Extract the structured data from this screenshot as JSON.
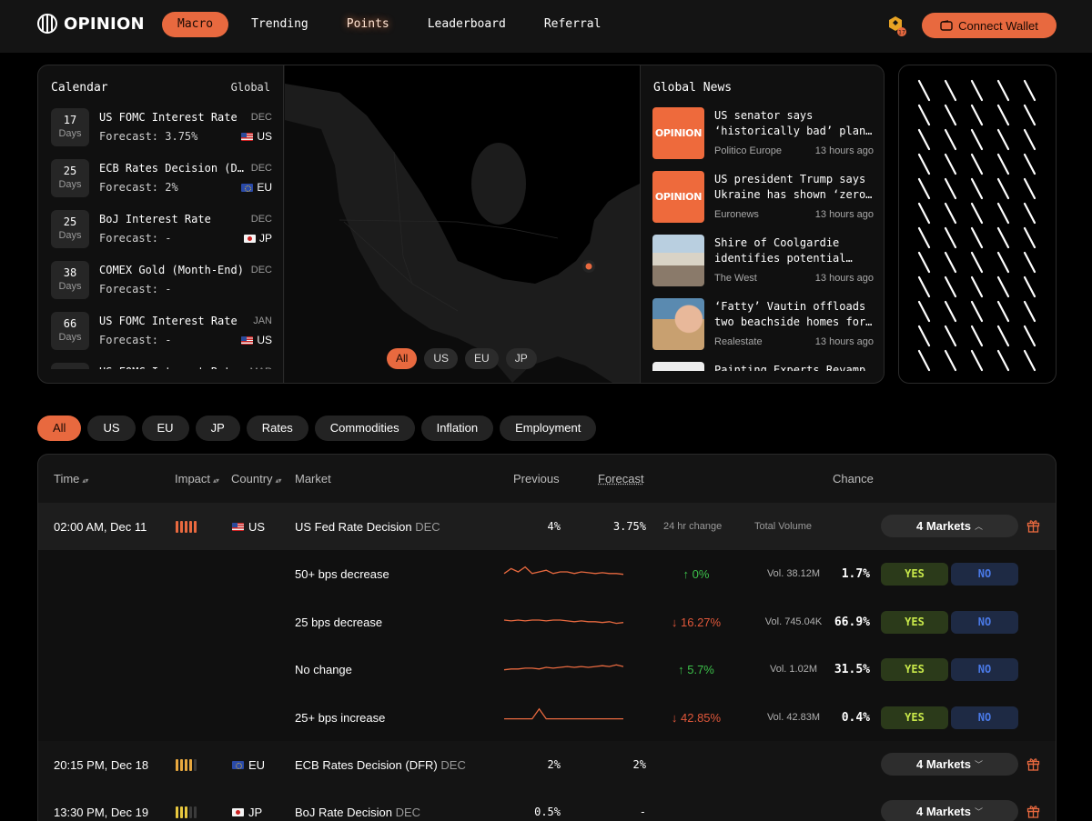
{
  "brand": {
    "name": "OPINION"
  },
  "nav": {
    "items": [
      {
        "label": "Macro",
        "active": true
      },
      {
        "label": "Trending"
      },
      {
        "label": "Points"
      },
      {
        "label": "Leaderboard"
      },
      {
        "label": "Referral"
      }
    ],
    "wallet_label": "Connect Wallet",
    "chain_icon": "bnb-chain-icon"
  },
  "calendar": {
    "title": "Calendar",
    "scope": "Global",
    "items": [
      {
        "days": "17",
        "days_label": "Days",
        "name": "US FOMC Interest Rate",
        "forecast": "Forecast: 3.75%",
        "month": "DEC",
        "country": "US"
      },
      {
        "days": "25",
        "days_label": "Days",
        "name": "ECB Rates Decision (DFR)",
        "forecast": "Forecast: 2%",
        "month": "DEC",
        "country": "EU"
      },
      {
        "days": "25",
        "days_label": "Days",
        "name": "BoJ Interest Rate",
        "forecast": "Forecast: -",
        "month": "DEC",
        "country": "JP"
      },
      {
        "days": "38",
        "days_label": "Days",
        "name": "COMEX Gold (Month-End)",
        "forecast": "Forecast: -",
        "month": "DEC",
        "country": ""
      },
      {
        "days": "66",
        "days_label": "Days",
        "name": "US FOMC Interest Rate",
        "forecast": "Forecast: -",
        "month": "JAN",
        "country": "US"
      },
      {
        "days": "",
        "days_label": "",
        "name": "US FOMC Interest Rate",
        "forecast": "",
        "month": "MAR",
        "country": ""
      }
    ]
  },
  "map": {
    "filters": [
      "All",
      "US",
      "EU",
      "JP"
    ],
    "active_filter": "All",
    "marker_color": "#e8693f"
  },
  "news": {
    "title": "Global News",
    "items": [
      {
        "line1": "US senator says",
        "line2": "‘historically bad’ plan…",
        "source": "Politico Europe",
        "time": "13 hours ago",
        "thumb": "opinion-logo"
      },
      {
        "line1": "US president Trump says",
        "line2": "Ukraine has shown ‘zero…",
        "source": "Euronews",
        "time": "13 hours ago",
        "thumb": "opinion-logo"
      },
      {
        "line1": "Shire of Coolgardie",
        "line2": "identifies potential…",
        "source": "The West",
        "time": "13 hours ago",
        "thumb": "photo-building"
      },
      {
        "line1": "‘Fatty’ Vautin offloads",
        "line2": "two beachside homes for…",
        "source": "Realestate",
        "time": "13 hours ago",
        "thumb": "photo-person"
      },
      {
        "line1": "Painting Experts Revamp",
        "line2": "",
        "source": "",
        "time": "",
        "thumb": "photo-paint"
      }
    ]
  },
  "filters": {
    "items": [
      "All",
      "US",
      "EU",
      "JP",
      "Rates",
      "Commodities",
      "Inflation",
      "Employment"
    ],
    "active": "All"
  },
  "table": {
    "headers": {
      "time": "Time",
      "impact": "Impact",
      "country": "Country",
      "market": "Market",
      "previous": "Previous",
      "forecast": "Forecast",
      "chance": "Chance"
    },
    "rows": [
      {
        "time": "02:00 AM, Dec 11",
        "impact": 5,
        "impact_color": "#e8693f",
        "country": "US",
        "market": "US Fed Rate Decision",
        "month": "DEC",
        "previous": "4%",
        "forecast": "3.75%",
        "col_change": "24 hr change",
        "col_volume": "Total Volume",
        "markets": "4 Markets",
        "expanded": true
      },
      {
        "time": "20:15 PM, Dec 18",
        "impact": 4,
        "impact_color": "#e8a83f",
        "country": "EU",
        "market": "ECB Rates Decision (DFR)",
        "month": "DEC",
        "previous": "2%",
        "forecast": "2%",
        "markets": "4 Markets"
      },
      {
        "time": "13:30 PM, Dec 19",
        "impact": 3,
        "impact_color": "#e8c83f",
        "country": "JP",
        "market": "BoJ Rate Decision",
        "month": "DEC",
        "previous": "0.5%",
        "forecast": "-",
        "markets": "4 Markets"
      }
    ],
    "sub_markets": [
      {
        "name": "50+ bps decrease",
        "change": "↑ 0%",
        "direction": "up",
        "volume": "Vol. 38.12M",
        "chance": "1.7%",
        "yes": "YES",
        "no": "NO",
        "trend": [
          0.6,
          0.3,
          0.5,
          0.2,
          0.6,
          0.5,
          0.4,
          0.6,
          0.5,
          0.5,
          0.6,
          0.5,
          0.55,
          0.6,
          0.55,
          0.6,
          0.6,
          0.65
        ]
      },
      {
        "name": "25 bps decrease",
        "change": "↓ 16.27%",
        "direction": "down",
        "volume": "Vol. 745.04K",
        "chance": "66.9%",
        "yes": "YES",
        "no": "NO",
        "trend": [
          0.5,
          0.55,
          0.5,
          0.55,
          0.5,
          0.5,
          0.55,
          0.5,
          0.5,
          0.55,
          0.6,
          0.55,
          0.6,
          0.6,
          0.65,
          0.6,
          0.7,
          0.65
        ]
      },
      {
        "name": "No change",
        "change": "↑ 5.7%",
        "direction": "up",
        "volume": "Vol. 1.02M",
        "chance": "31.5%",
        "yes": "YES",
        "no": "NO",
        "trend": [
          0.65,
          0.6,
          0.6,
          0.55,
          0.55,
          0.6,
          0.5,
          0.55,
          0.5,
          0.45,
          0.5,
          0.45,
          0.5,
          0.45,
          0.4,
          0.45,
          0.35,
          0.45
        ]
      },
      {
        "name": "25+ bps increase",
        "change": "↓ 42.85%",
        "direction": "down",
        "volume": "Vol. 42.83M",
        "chance": "0.4%",
        "yes": "YES",
        "no": "NO",
        "trend": [
          0.7,
          0.7,
          0.7,
          0.7,
          0.7,
          0.1,
          0.7,
          0.7,
          0.7,
          0.7,
          0.7,
          0.7,
          0.7,
          0.7,
          0.7,
          0.7,
          0.7,
          0.7
        ]
      }
    ]
  },
  "colors": {
    "accent": "#e8693f",
    "up": "#3cc04a",
    "down": "#e0573a",
    "yes": "#c8e84a",
    "no": "#4a7ae8"
  }
}
